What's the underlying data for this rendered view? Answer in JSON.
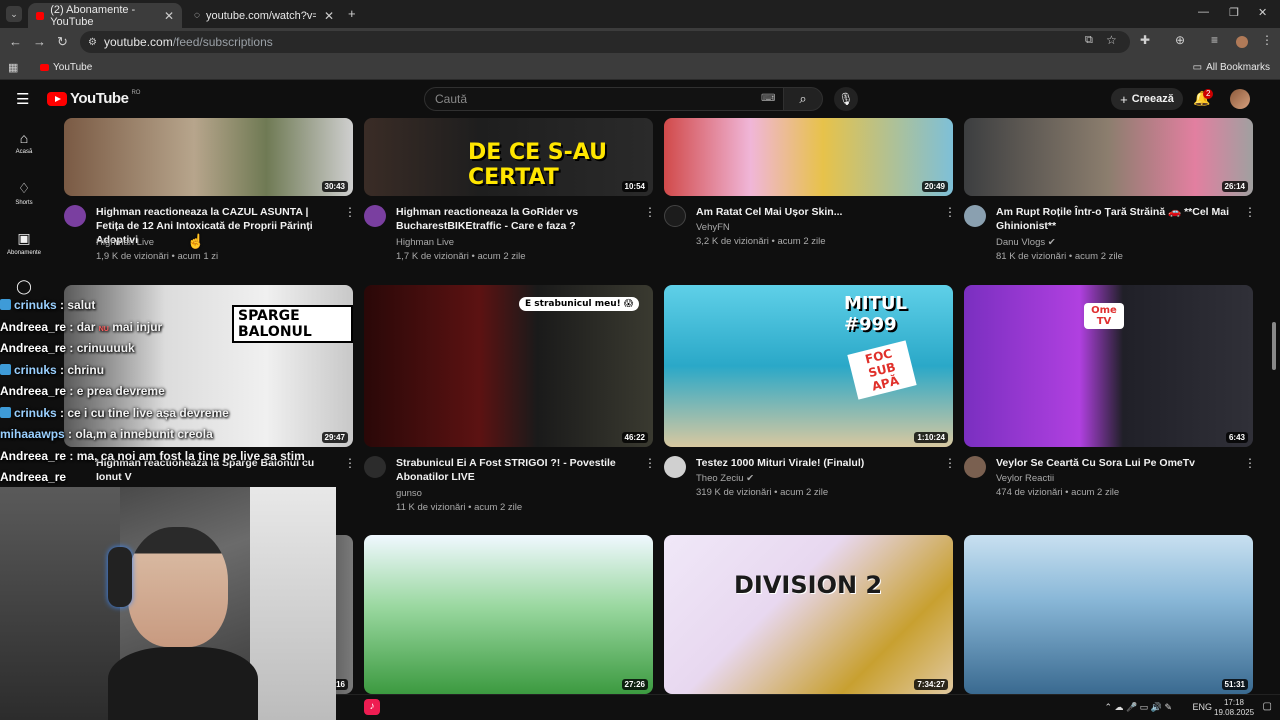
{
  "browser": {
    "tabs": [
      {
        "label": "(2) Abonamente - YouTube",
        "active": true
      },
      {
        "label": "youtube.com/watch?v=xUsEF8...",
        "active": false
      }
    ],
    "new_tab": "+",
    "url_host": "youtube.com",
    "url_path": "/feed/subscriptions",
    "bookmark": "YouTube",
    "all_bookmarks": "All Bookmarks",
    "window_controls": [
      "—",
      "❐",
      "✕"
    ]
  },
  "youtube": {
    "logo_text": "YouTube",
    "country": "RO",
    "search_placeholder": "Caută",
    "create_label": "Creează",
    "notification_count": "2"
  },
  "sidebar": {
    "items": [
      {
        "label": "Acasă",
        "icon": "home-icon"
      },
      {
        "label": "Shorts",
        "icon": "shorts-icon"
      },
      {
        "label": "Abonamente",
        "icon": "subscriptions-icon"
      }
    ]
  },
  "videos": [
    {
      "title": "Highman reactioneaza la CAZUL ASUNTA | Fetița de 12 Ani Intoxicată de Proprii Părinți Adoptivi",
      "channel": "Highman Live",
      "views": "1,9 K de vizionări",
      "age": "acum 1 zi",
      "duration": "30:43",
      "verified": false
    },
    {
      "title": "Highman reactioneaza la GoRider vs BucharestBIKEtraffic - Care e faza ?",
      "channel": "Highman Live",
      "views": "1,7 K de vizionări",
      "age": "acum 2 zile",
      "duration": "10:54",
      "verified": false,
      "thumb_text": "DE CE S-AU CERTAT"
    },
    {
      "title": "Am Ratat Cel Mai Ușor Skin...",
      "channel": "VehyFN",
      "views": "3,2 K de vizionări",
      "age": "acum 2 zile",
      "duration": "20:49",
      "verified": false
    },
    {
      "title": "Am Rupt Roțile Într-o Țară Străină 🚗 **Cel Mai Ghinionist**",
      "channel": "Danu Vlogs",
      "views": "81 K de vizionări",
      "age": "acum 2 zile",
      "duration": "26:14",
      "verified": true
    },
    {
      "title": "Highman reactioneaza la Sparge Balonul cu Ionut V",
      "channel": "",
      "views": "",
      "age": "",
      "duration": "29:47",
      "verified": false,
      "thumb_text": "SPARGE BALONUL"
    },
    {
      "title": "Strabunicul Ei A Fost STRIGOI ?! - Povestile Abonatilor LIVE",
      "channel": "gunso",
      "views": "11 K de vizionări",
      "age": "acum 2 zile",
      "duration": "46:22",
      "verified": false,
      "thumb_text": "E strabunicul meu! 😱"
    },
    {
      "title": "Testez 1000 Mituri Virale! (Finalul)",
      "channel": "Theo Zeciu",
      "views": "319 K de vizionări",
      "age": "acum 2 zile",
      "duration": "1:10:24",
      "verified": true,
      "thumb_text": "MITUL #999",
      "thumb_text2": "FOC SUB APĂ"
    },
    {
      "title": "Veylor Se Ceartă Cu Sora Lui Pe OmeTv",
      "channel": "Veylor Reactii",
      "views": "474 de vizionări",
      "age": "acum 2 zile",
      "duration": "6:43",
      "verified": false,
      "thumb_text": "Ome TV"
    },
    {
      "duration": "16"
    },
    {
      "duration": "27:26"
    },
    {
      "duration": "7:34:27",
      "thumb_text": "DIVISION 2"
    },
    {
      "duration": "51:31"
    }
  ],
  "chat": [
    {
      "user": "crinuks",
      "msg": ": salut",
      "badge": true,
      "blue": false
    },
    {
      "user": "Andreea_re",
      "msg": ": dar",
      "extra": "mai injur",
      "badge": false
    },
    {
      "user": "Andreea_re",
      "msg": ": crinuuuuk",
      "badge": false
    },
    {
      "user": "crinuks",
      "msg": ": chrinu",
      "badge": true
    },
    {
      "user": "Andreea_re",
      "msg": ": e prea devreme",
      "badge": false
    },
    {
      "user": "crinuks",
      "msg": ": ce i cu tine live așa devreme",
      "badge": true
    },
    {
      "user": "mihaaawps",
      "msg": ": ola,m a innebunit creola",
      "badge": false,
      "blue": true
    },
    {
      "user": "Andreea_re",
      "msg": ": ma, ca noi am fost la tine pe live sa stim",
      "badge": false
    },
    {
      "user": "Andreea_re",
      "msg": "",
      "badge": false
    }
  ],
  "taskbar": {
    "lang": "ENG",
    "time": "17:18",
    "date": "19.08.2025"
  },
  "colors": {
    "bg": "#0f0f0f",
    "accent_red": "#ff0000",
    "chrome_dark": "#1f1f1f",
    "chrome": "#3c3c3c"
  }
}
